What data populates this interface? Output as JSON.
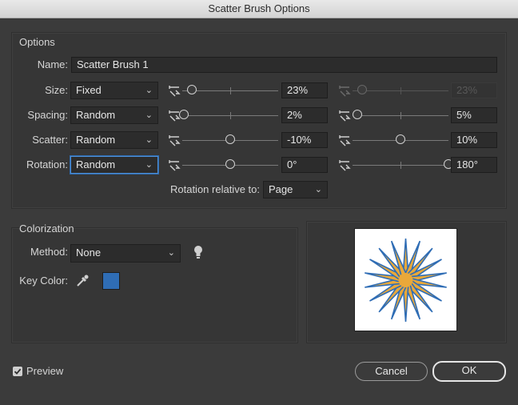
{
  "window": {
    "title": "Scatter Brush Options"
  },
  "options": {
    "title": "Options",
    "name_label": "Name:",
    "name_value": "Scatter Brush 1",
    "rows": [
      {
        "key": "size",
        "label": "Size:",
        "method": "Fixed",
        "value1": "23%",
        "value2": "23%",
        "pos1": 0.1,
        "pos2": 0.1,
        "second_disabled": true
      },
      {
        "key": "spacing",
        "label": "Spacing:",
        "method": "Random",
        "value1": "2%",
        "value2": "5%",
        "pos1": 0.02,
        "pos2": 0.05,
        "second_disabled": false
      },
      {
        "key": "scatter",
        "label": "Scatter:",
        "method": "Random",
        "value1": "-10%",
        "value2": "10%",
        "pos1": 0.5,
        "pos2": 0.5,
        "second_disabled": false
      },
      {
        "key": "rotation",
        "label": "Rotation:",
        "method": "Random",
        "value1": "0°",
        "value2": "180°",
        "pos1": 0.5,
        "pos2": 1.0,
        "second_disabled": false
      }
    ],
    "rotation_relative_label": "Rotation relative to:",
    "rotation_relative_value": "Page"
  },
  "colorization": {
    "title": "Colorization",
    "method_label": "Method:",
    "method_value": "None",
    "key_color_label": "Key Color:",
    "key_color": "#2f6db5",
    "tip_icon": "lightbulb-icon",
    "eyedropper_icon": "eyedropper-icon"
  },
  "preview_art": {
    "fill": "#e8a83a",
    "stroke": "#2f6db5"
  },
  "footer": {
    "preview_label": "Preview",
    "preview_checked": true,
    "cancel_label": "Cancel",
    "ok_label": "OK"
  }
}
